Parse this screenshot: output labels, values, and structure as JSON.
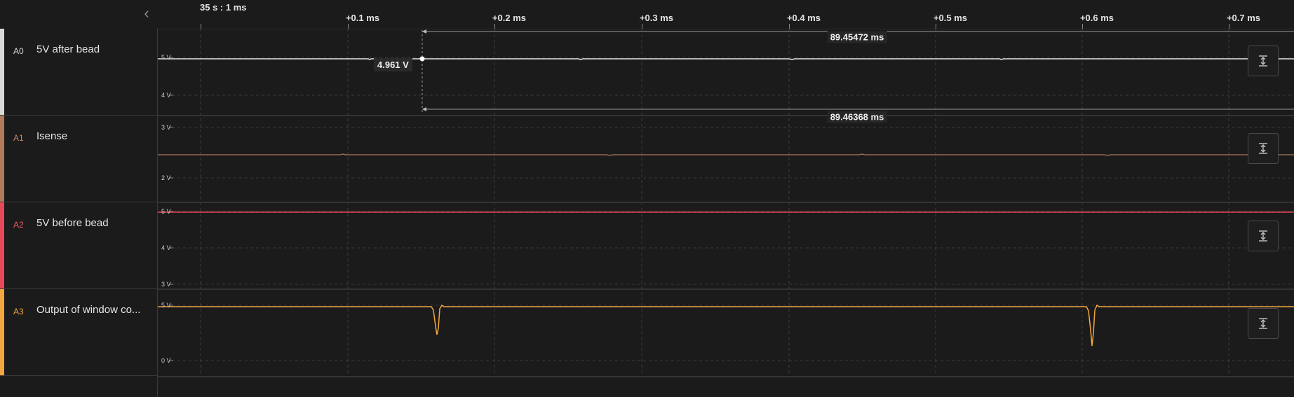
{
  "timeline": {
    "origin_label": "35 s : 1 ms",
    "ticks": [
      "+0.1 ms",
      "+0.2 ms",
      "+0.3 ms",
      "+0.4 ms",
      "+0.5 ms",
      "+0.6 ms",
      "+0.7 ms"
    ]
  },
  "channels": [
    {
      "id": "A0",
      "name": "5V after bead",
      "color": "#d9d9d9",
      "id_color": "#d9d9d9",
      "y_labels": [
        "5 V",
        "4 V"
      ]
    },
    {
      "id": "A1",
      "name": "Isense",
      "color": "#b07a5b",
      "id_color": "#c98a66",
      "y_labels": [
        "3 V",
        "2 V"
      ]
    },
    {
      "id": "A2",
      "name": "5V before bead",
      "color": "#e8485a",
      "id_color": "#ef5a6a",
      "y_labels": [
        "5 V",
        "4 V",
        "3 V"
      ]
    },
    {
      "id": "A3",
      "name": "Output of window co...",
      "color": "#f3a640",
      "id_color": "#f3a640",
      "y_labels": [
        "5 V",
        "0 V"
      ]
    }
  ],
  "measurements": {
    "cursor_value": "4.961 V",
    "top_delta": "89.45472 ms",
    "bottom_delta": "89.46368 ms"
  },
  "icons": {
    "collapse": "chevron-left-icon",
    "autofit": "fit-vertical-icon"
  }
}
